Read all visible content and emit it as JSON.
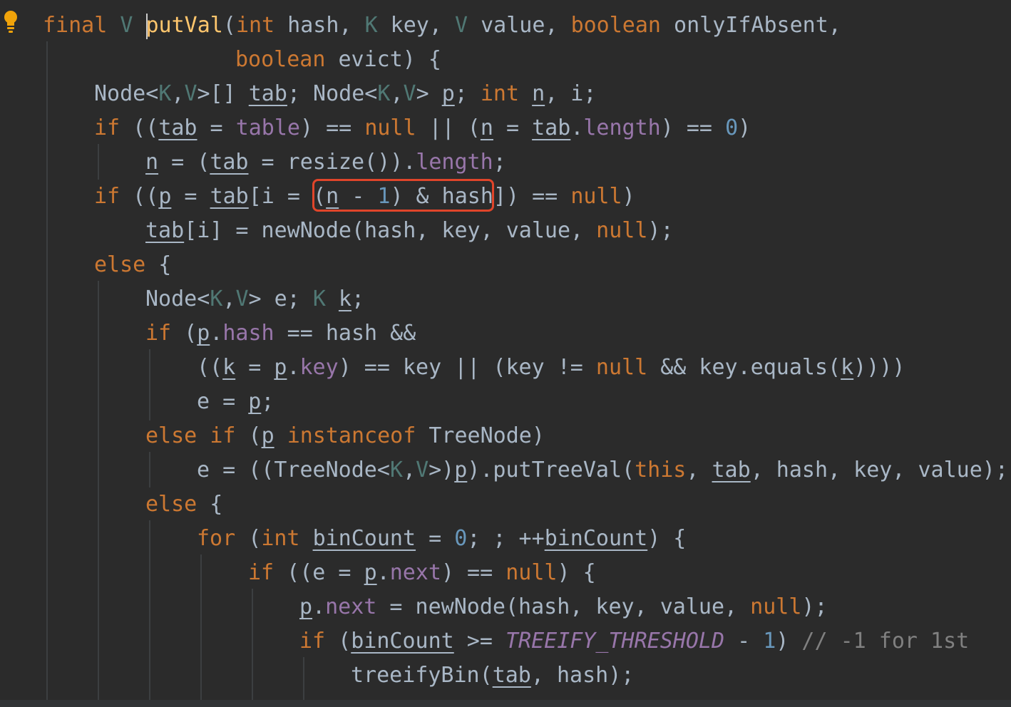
{
  "editor": {
    "language": "Java",
    "intention_icon": "lightbulb-icon",
    "highlight_box_color": "#e0452a",
    "background_color": "#2b2b2b"
  },
  "tokens": {
    "t_final": "final",
    "t_V1": "V",
    "t_putVal": "putVal",
    "t_sig1": "(int hash, K key, V value, boolean onlyIfAbsent,",
    "t_boolean2": "boolean",
    "t_evict": " evict) {",
    "l3": "Node<K,V>[] tab; Node<K,V> p; int n, i;",
    "l4": "if ((tab = table) == null || (n = tab.length) == 0)",
    "l5": "n = (tab = resize()).length;",
    "l6_pre": "if ((p = tab[i = ",
    "l6_box": "(n - 1) & hash",
    "l6_post": "]) == null)",
    "l7": "tab[i] = newNode(hash, key, value, null);",
    "l8": "else {",
    "l9": "Node<K,V> e; K k;",
    "l10": "if (p.hash == hash &&",
    "l11": "((k = p.key) == key || (key != null && key.equals(k))))",
    "l12": "e = p;",
    "l13": "else if (p instanceof TreeNode)",
    "l14": "e = ((TreeNode<K,V>)p).putTreeVal(this, tab, hash, key, value);",
    "l15": "else {",
    "l16": "for (int binCount = 0; ; ++binCount) {",
    "l17": "if ((e = p.next) == null) {",
    "l18": "p.next = newNode(hash, key, value, null);",
    "l19": "if (binCount >= TREEIFY_THRESHOLD - 1) // -1 for 1st",
    "l20": "treeifyBin(tab, hash);"
  }
}
